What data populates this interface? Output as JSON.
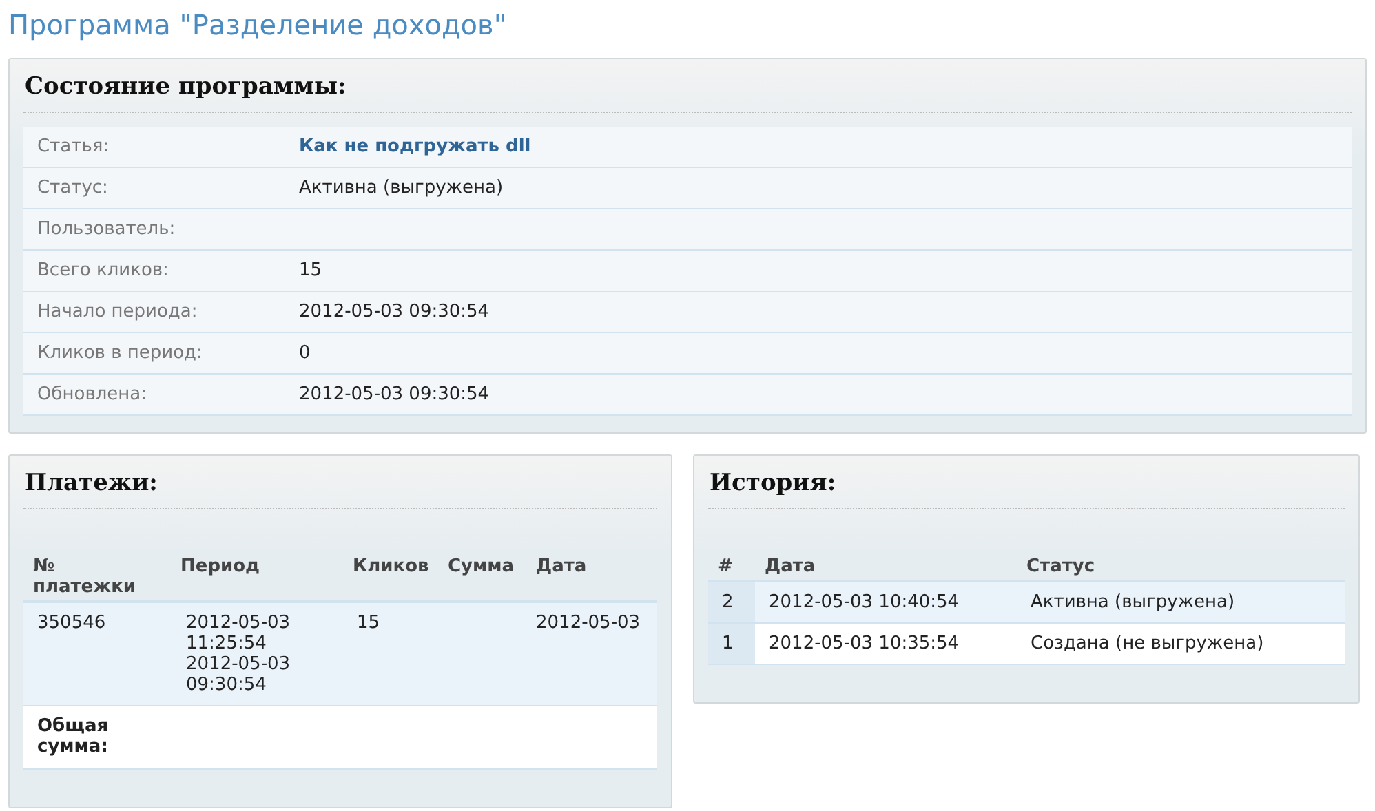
{
  "page_title": "Программа \"Разделение доходов\"",
  "status_panel": {
    "title": "Состояние программы:",
    "rows": [
      {
        "label": "Статья:",
        "value": "Как не подгружать dll",
        "kind": "link"
      },
      {
        "label": "Статус:",
        "value": "Активна (выгружена)",
        "kind": "text"
      },
      {
        "label": "Пользователь:",
        "kind": "text"
      },
      {
        "label": "Всего кликов:",
        "value": "15",
        "kind": "text"
      },
      {
        "label": "Начало периода:",
        "value": "2012-05-03 09:30:54",
        "kind": "text"
      },
      {
        "label": "Кликов в период:",
        "value": "0",
        "kind": "text"
      },
      {
        "label": "Обновлена:",
        "value": "2012-05-03 09:30:54",
        "kind": "text"
      }
    ]
  },
  "payments_panel": {
    "title": "Платежи:",
    "columns": [
      "№ платежки",
      "Период",
      "Кликов",
      "Сумма",
      "Дата"
    ],
    "rows": [
      {
        "number": "350546",
        "period": [
          "2012-05-03 11:25:54",
          "2012-05-03 09:30:54"
        ],
        "clicks": "15",
        "date": "2012-05-03"
      }
    ],
    "total_label": "Общая сумма:"
  },
  "history_panel": {
    "title": "История:",
    "columns": [
      "#",
      "Дата",
      "Статус"
    ],
    "rows": [
      {
        "cells": [
          "2",
          "2012-05-03 10:40:54",
          "Активна (выгружена)"
        ]
      },
      {
        "cells": [
          "1",
          "2012-05-03 10:35:54",
          "Создана (не выгружена)"
        ]
      }
    ]
  }
}
